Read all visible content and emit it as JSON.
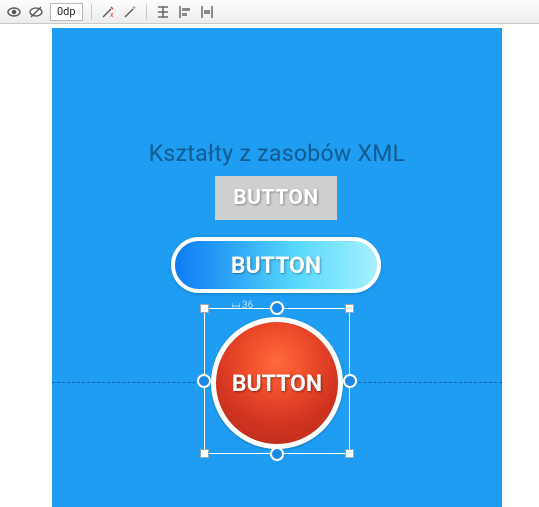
{
  "toolbar": {
    "viewport_text": "0dp",
    "icons": {
      "eye": "eye-icon",
      "remove_overlay": "strike-eye-icon",
      "magic_x": "wand-x-icon",
      "magic": "wand-icon",
      "align1": "distribute-vertical-icon",
      "align2": "align-left-icon",
      "align3": "align-vertical-center-icon"
    }
  },
  "canvas": {
    "title": "Kształty z zasobów XML",
    "button1_label": "BUTTON",
    "button2_label": "BUTTON",
    "button3_label": "BUTTON",
    "measure_label": "36"
  }
}
